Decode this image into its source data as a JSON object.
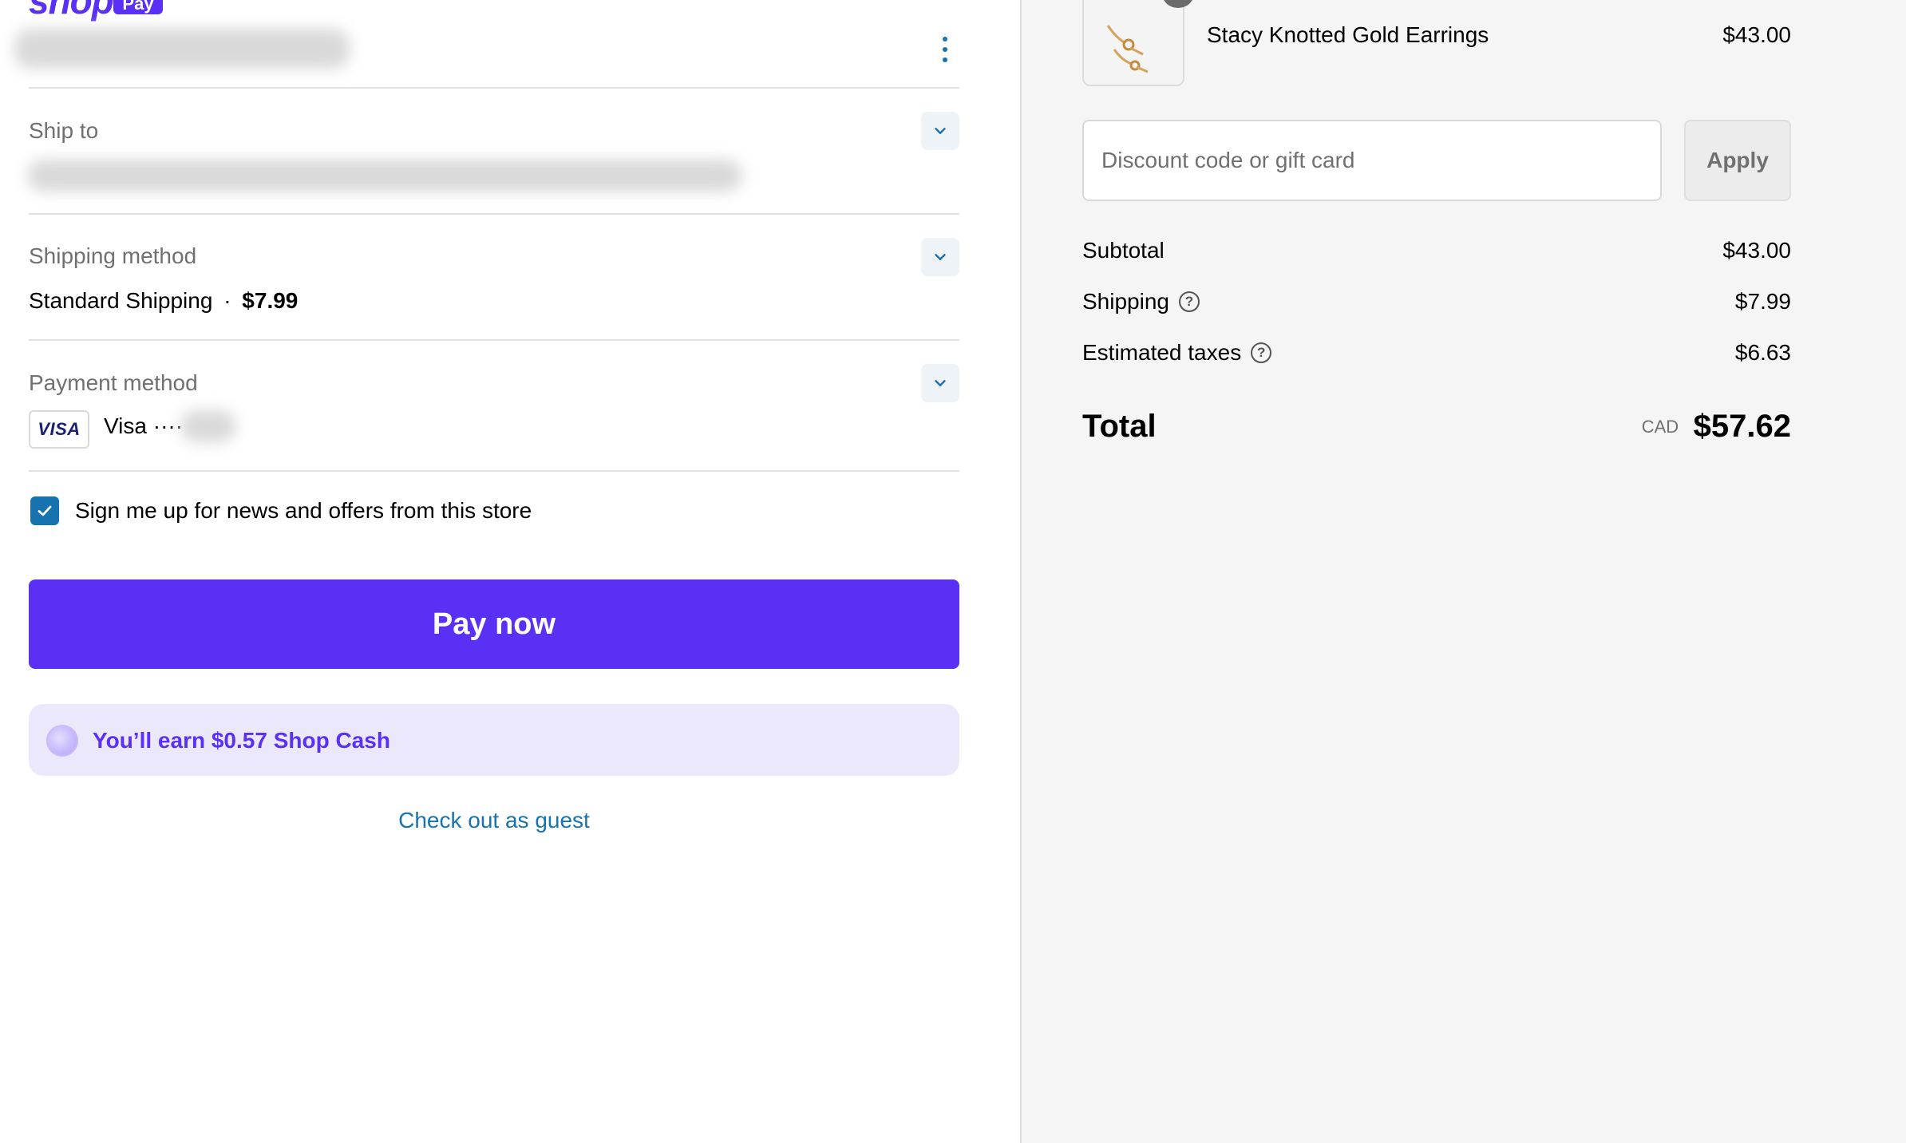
{
  "logo": {
    "word": "shop",
    "badge": "Pay"
  },
  "sections": {
    "ship_to": {
      "label": "Ship to"
    },
    "shipping_method": {
      "label": "Shipping method",
      "name": "Standard Shipping",
      "separator": "·",
      "price": "$7.99"
    },
    "payment_method": {
      "label": "Payment method",
      "card_brand": "VISA",
      "card_text": "Visa ····"
    }
  },
  "newsletter": {
    "label": "Sign me up for news and offers from this store",
    "checked": true
  },
  "pay_button": {
    "label": "Pay now"
  },
  "shop_cash": {
    "text": "You’ll earn $0.57 Shop Cash"
  },
  "guest_link": {
    "label": "Check out as guest"
  },
  "order": {
    "product": {
      "name": "Stacy Knotted Gold Earrings",
      "price": "$43.00"
    },
    "discount": {
      "placeholder": "Discount code or gift card",
      "apply_label": "Apply"
    },
    "summary": {
      "subtotal": {
        "label": "Subtotal",
        "value": "$43.00"
      },
      "shipping": {
        "label": "Shipping",
        "value": "$7.99"
      },
      "taxes": {
        "label": "Estimated taxes",
        "value": "$6.63"
      }
    },
    "total": {
      "label": "Total",
      "currency": "CAD",
      "value": "$57.62"
    }
  },
  "icons": {
    "help": "?",
    "chevron": "chevron-down-icon",
    "menu": "kebab-menu-icon"
  },
  "colors": {
    "brand": "#5a31f4",
    "link": "#1773b0",
    "cash_bg": "#ebe8fc"
  }
}
